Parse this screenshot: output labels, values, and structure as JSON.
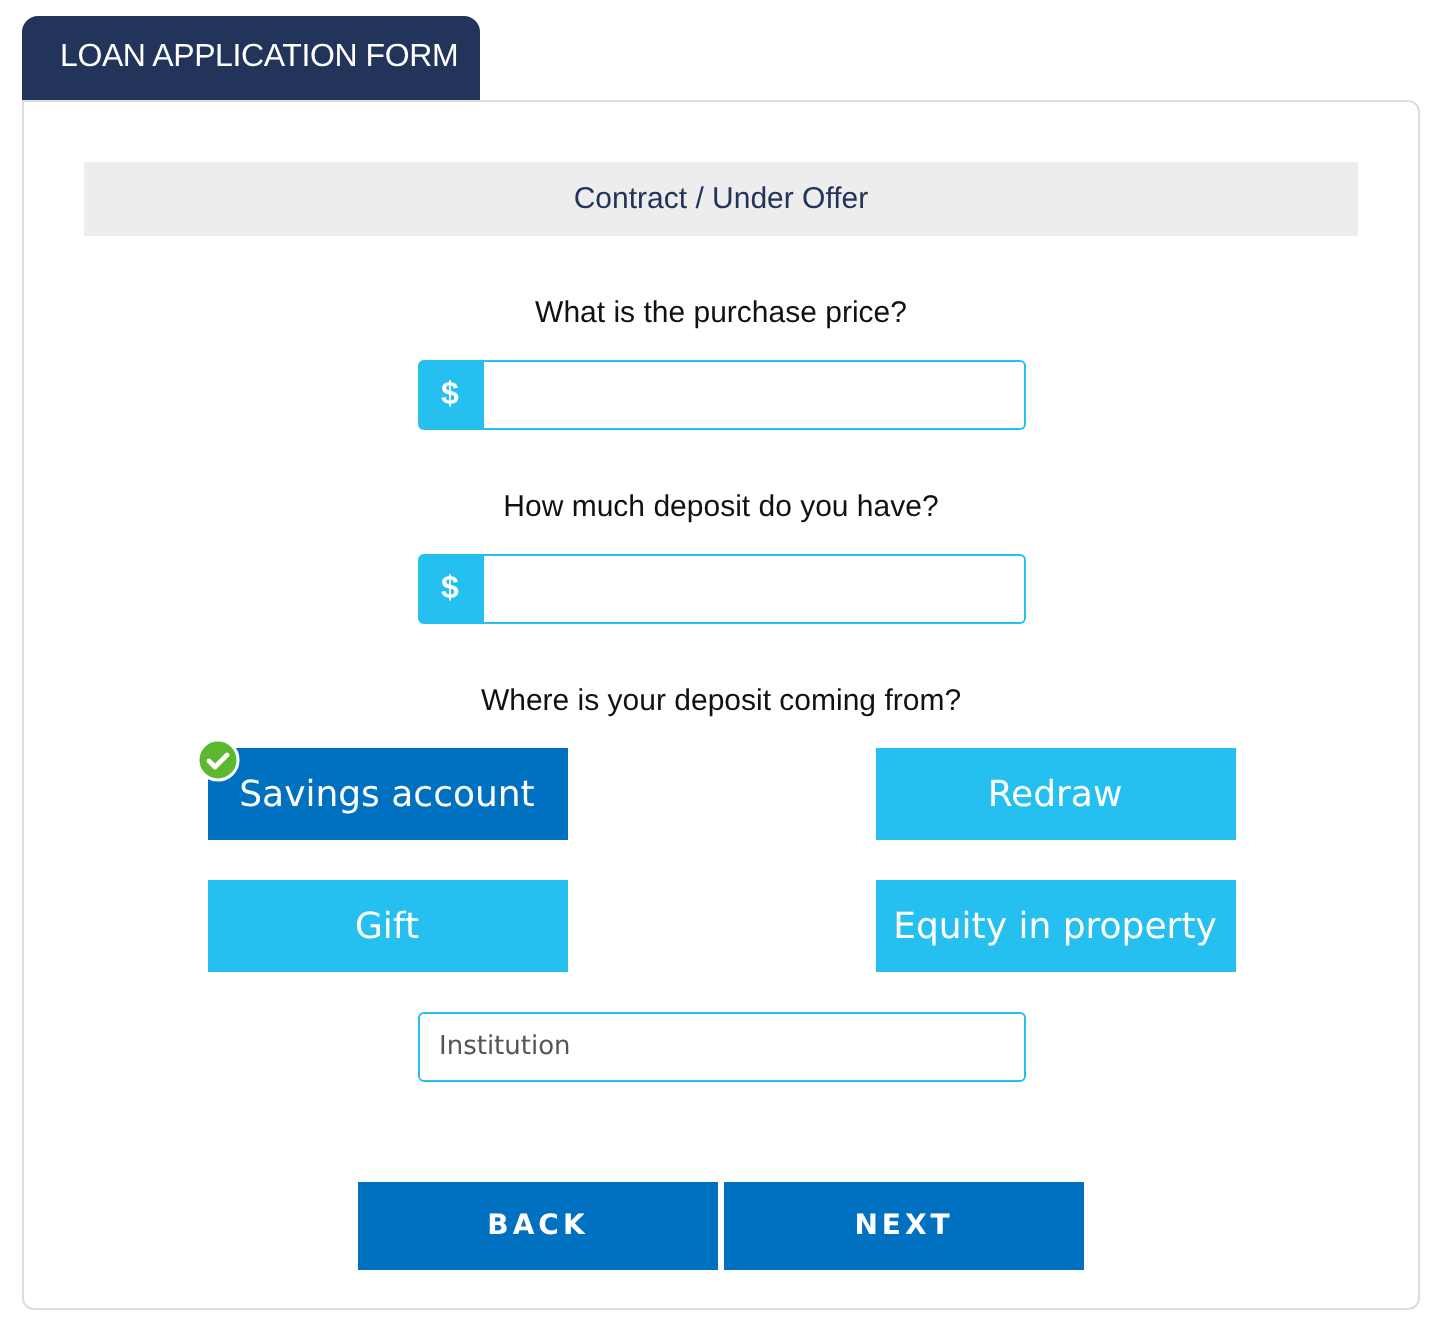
{
  "tab": {
    "label": "LOAN APPLICATION FORM"
  },
  "section": {
    "title": "Contract / Under Offer"
  },
  "questions": [
    {
      "label": "What is the purchase price?",
      "prefix": "$"
    },
    {
      "label": "How much deposit do you have?",
      "prefix": "$"
    }
  ],
  "deposit_source": {
    "label": "Where is your deposit coming from?",
    "options": [
      {
        "label": "Savings account",
        "selected": true
      },
      {
        "label": "Redraw",
        "selected": false
      },
      {
        "label": "Gift",
        "selected": false
      },
      {
        "label": "Equity in property",
        "selected": false
      }
    ]
  },
  "institution": {
    "placeholder": "Institution"
  },
  "buttons": [
    "BACK",
    "NEXT"
  ]
}
